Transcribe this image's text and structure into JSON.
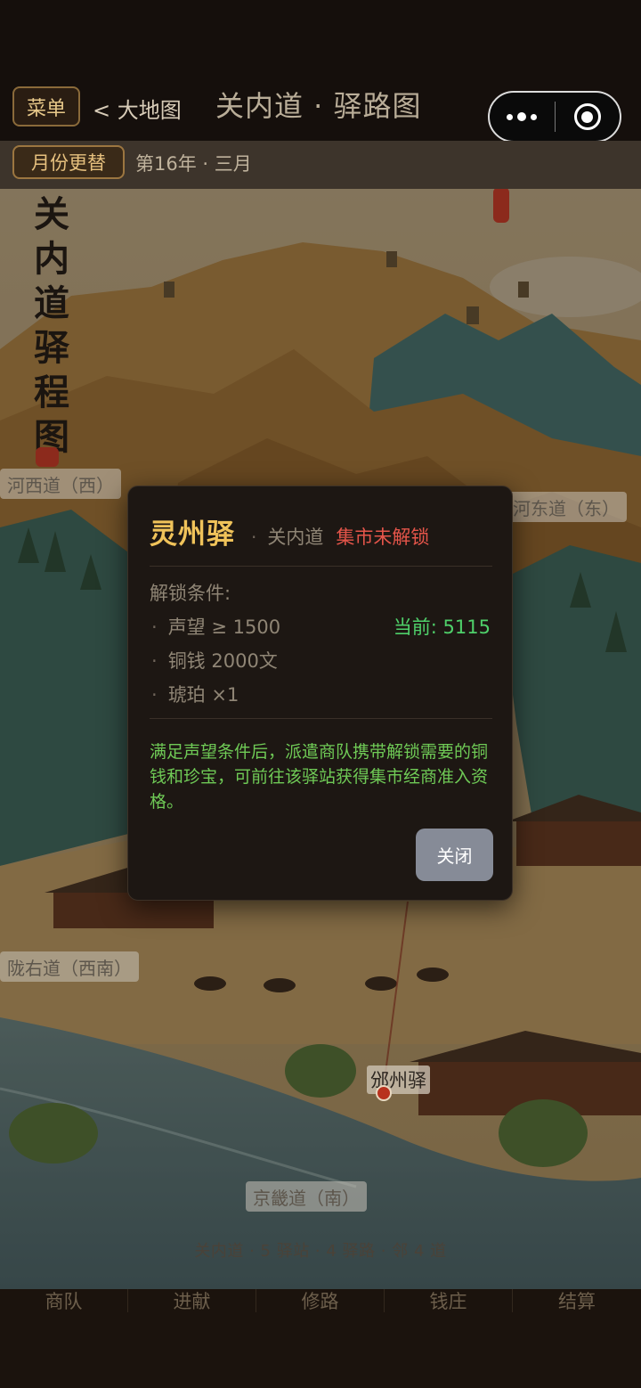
{
  "header": {
    "menu_label": "菜单",
    "back_label": "< 大地图",
    "title": "关内道 · 驿路图"
  },
  "datebar": {
    "month_button": "月份更替",
    "date_text": "第16年 · 三月"
  },
  "map": {
    "scroll_title": "关内道驿程图",
    "regions": {
      "west": "河西道（西）",
      "east": "河东道（东）",
      "southwest": "陇右道（西南）",
      "south": "京畿道（南）"
    },
    "station_name": "邠州驿",
    "stats": "关内道 · 5 驿站 · 4 驿路 · 邻 4 道"
  },
  "bottom_nav": {
    "items": [
      "商队",
      "进献",
      "修路",
      "钱庄",
      "结算"
    ]
  },
  "modal": {
    "title": "灵州驿",
    "separator": "·",
    "region": "关内道",
    "status": "集市未解锁",
    "conditions_heading": "解锁条件:",
    "conditions": [
      "声望 ≥ 1500",
      "铜钱 2000文",
      "琥珀 ×1"
    ],
    "bullet": "·",
    "current_label": "当前: 5115",
    "description": "满足声望条件后，派遣商队携带解锁需要的铜钱和珍宝，可前往该驿站获得集市经商准入资格。",
    "close_label": "关闭"
  },
  "colors": {
    "accent_gold": "#f0c35a",
    "status_red": "#e5554a",
    "status_green": "#4fd06a",
    "desc_green": "#6fca56"
  }
}
